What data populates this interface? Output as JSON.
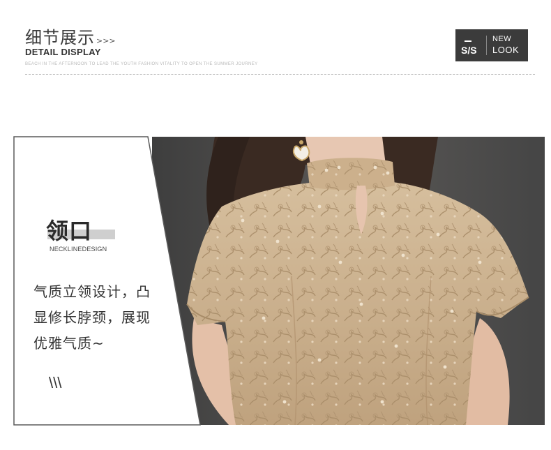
{
  "header": {
    "title_cn": "细节展示",
    "title_arrows": ">>>",
    "title_en": "DETAIL DISPLAY",
    "subtitle": "BEACH IN THE AFTERNOON TO LEAD THE YOUTH FASHION  VITALITY TO OPEN THE SUMMER  JOURNEY"
  },
  "badge": {
    "season": "S/S",
    "line1": "NEW",
    "line2": "LOOK"
  },
  "panel": {
    "title_cn": "领口",
    "title_en": "NECKLINEDESIGN",
    "desc_lines": [
      "气质立领设计，凸",
      "显修长脖颈，展现",
      "优雅气质~"
    ],
    "slashes": "\\\\\\"
  },
  "photo": {
    "subject": "champagne-lace-stand-collar-dress"
  },
  "colors": {
    "badge_bg": "#3b3b3b",
    "lace": "#c9ad8a",
    "backdrop": "#4a4a4a"
  }
}
